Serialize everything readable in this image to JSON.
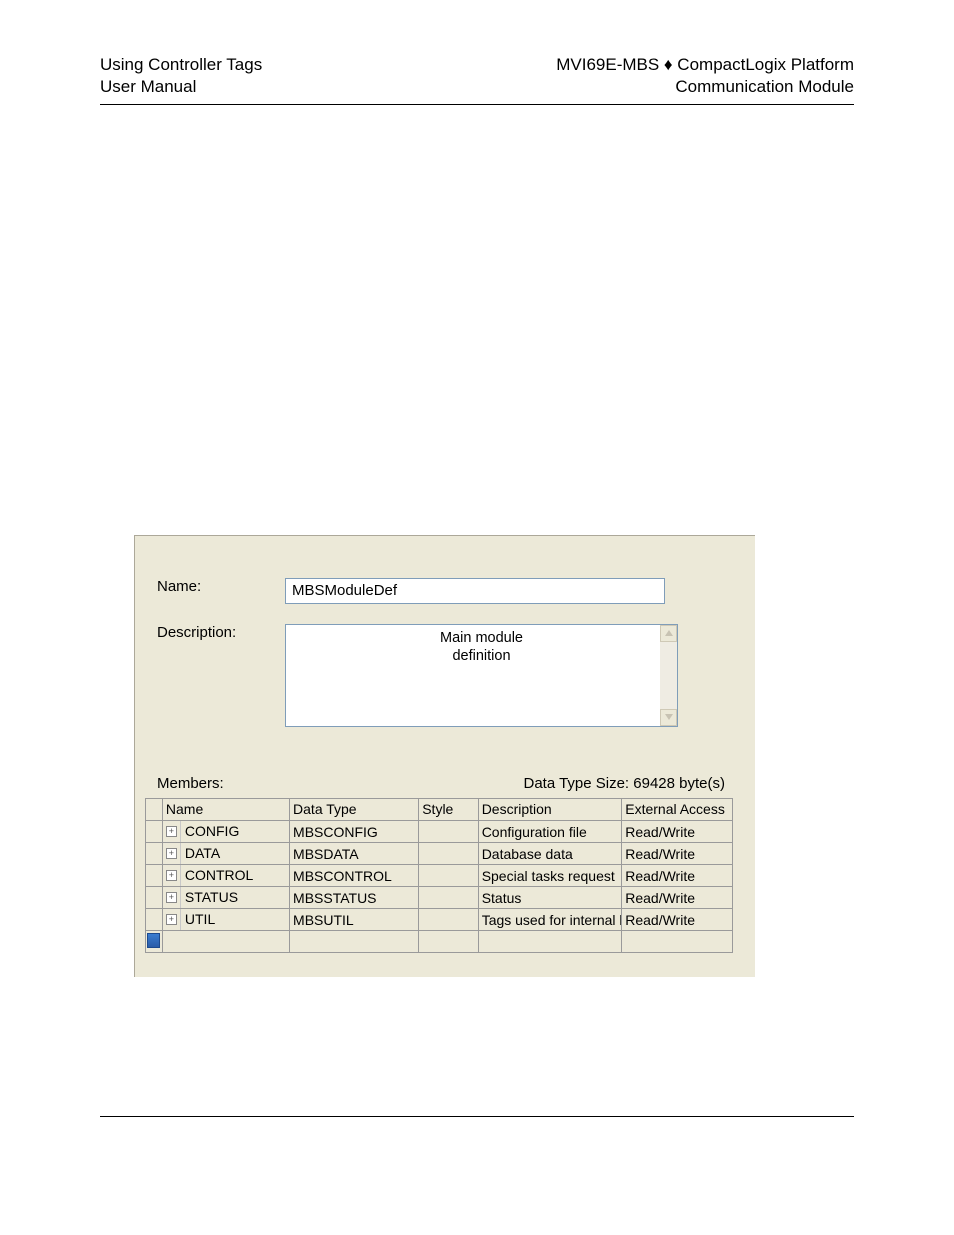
{
  "header": {
    "left_line1": "Using Controller Tags",
    "left_line2": "User Manual",
    "right_line1": "MVI69E-MBS ♦ CompactLogix Platform",
    "right_line2": "Communication Module"
  },
  "panel": {
    "name_label": "Name:",
    "name_value": "MBSModuleDef",
    "description_label": "Description:",
    "description_value": "Main module\ndefinition",
    "members_label": "Members:",
    "size_label": "Data Type Size: 69428 byte(s)"
  },
  "grid": {
    "headers": {
      "name": "Name",
      "data_type": "Data Type",
      "style": "Style",
      "description": "Description",
      "external_access": "External Access"
    },
    "rows": [
      {
        "name": "CONFIG",
        "data_type": "MBSCONFIG",
        "style": "",
        "description": "Configuration file",
        "external_access": "Read/Write"
      },
      {
        "name": "DATA",
        "data_type": "MBSDATA",
        "style": "",
        "description": "Database data",
        "external_access": "Read/Write"
      },
      {
        "name": "CONTROL",
        "data_type": "MBSCONTROL",
        "style": "",
        "description": "Special tasks request",
        "external_access": "Read/Write"
      },
      {
        "name": "STATUS",
        "data_type": "MBSSTATUS",
        "style": "",
        "description": "Status",
        "external_access": "Read/Write"
      },
      {
        "name": "UTIL",
        "data_type": "MBSUTIL",
        "style": "",
        "description": "Tags used for internal l",
        "external_access": "Read/Write"
      }
    ]
  }
}
